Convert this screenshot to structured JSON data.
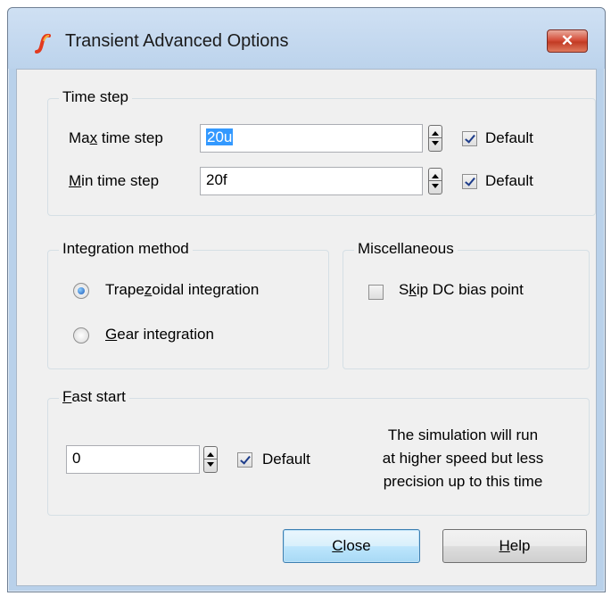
{
  "window": {
    "title": "Transient Advanced Options",
    "close_glyph": "✕"
  },
  "time_step": {
    "group_label": "Time step",
    "max": {
      "label_pre": "Ma",
      "label_mnemonic": "x",
      "label_post": " time step",
      "value": "20u",
      "default_label": "Default",
      "default_checked": true
    },
    "min": {
      "label_mnemonic": "M",
      "label_post": "in time step",
      "value": "20f",
      "default_label": "Default",
      "default_checked": true
    }
  },
  "integration": {
    "group_label": "Integration method",
    "trapezoidal": {
      "label_pre": "Trape",
      "label_mnemonic": "z",
      "label_post": "oidal integration",
      "selected": true
    },
    "gear": {
      "label_mnemonic": "G",
      "label_post": "ear integration",
      "selected": false
    }
  },
  "misc": {
    "group_label": "Miscellaneous",
    "skip_dc": {
      "label_pre": "S",
      "label_mnemonic": "k",
      "label_post": "ip DC bias point",
      "checked": false
    }
  },
  "fast_start": {
    "group_label_mnemonic": "F",
    "group_label_post": "ast start",
    "value": "0",
    "default_label": "Default",
    "default_checked": true,
    "note_line1": "The simulation will run",
    "note_line2": "at higher speed but less",
    "note_line3": "precision up to this time"
  },
  "buttons": {
    "close": {
      "mnemonic": "C",
      "post": "lose"
    },
    "help": {
      "mnemonic": "H",
      "post": "elp"
    }
  },
  "icons": {
    "app": "simetrix-logo-icon",
    "spinner": "spin-updown-icon"
  }
}
